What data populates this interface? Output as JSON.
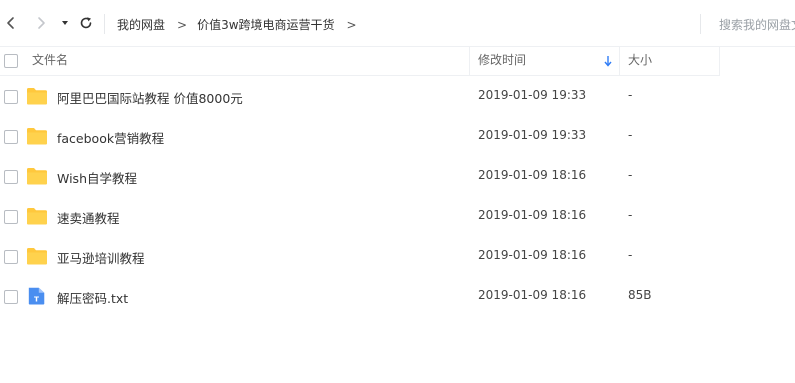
{
  "toolbar": {
    "back_icon": "chevron-left-icon",
    "forward_icon": "chevron-right-icon",
    "dropdown_icon": "caret-down-icon",
    "refresh_icon": "refresh-icon",
    "breadcrumb": [
      {
        "label": "我的网盘"
      },
      {
        "label": "价值3w跨境电商运营干货"
      }
    ],
    "breadcrumb_separator": ">",
    "search_placeholder": "搜索我的网盘文"
  },
  "table": {
    "columns": {
      "name": "文件名",
      "modified": "修改时间",
      "size": "大小"
    },
    "sort_icon": "sort-down-arrow-icon",
    "rows": [
      {
        "type": "folder",
        "name": "阿里巴巴国际站教程  价值8000元",
        "modified": "2019-01-09 19:33",
        "size": "-"
      },
      {
        "type": "folder",
        "name": "facebook营销教程",
        "modified": "2019-01-09 19:33",
        "size": "-"
      },
      {
        "type": "folder",
        "name": "Wish自学教程",
        "modified": "2019-01-09 18:16",
        "size": "-"
      },
      {
        "type": "folder",
        "name": "速卖通教程",
        "modified": "2019-01-09 18:16",
        "size": "-"
      },
      {
        "type": "folder",
        "name": "亚马逊培训教程",
        "modified": "2019-01-09 18:16",
        "size": "-"
      },
      {
        "type": "text-file",
        "name": "解压密码.txt",
        "modified": "2019-01-09 18:16",
        "size": "85B"
      }
    ]
  },
  "colors": {
    "folder": "#ffc83d",
    "txt_file": "#4a8ef0",
    "sort_arrow": "#2f7cf6"
  }
}
